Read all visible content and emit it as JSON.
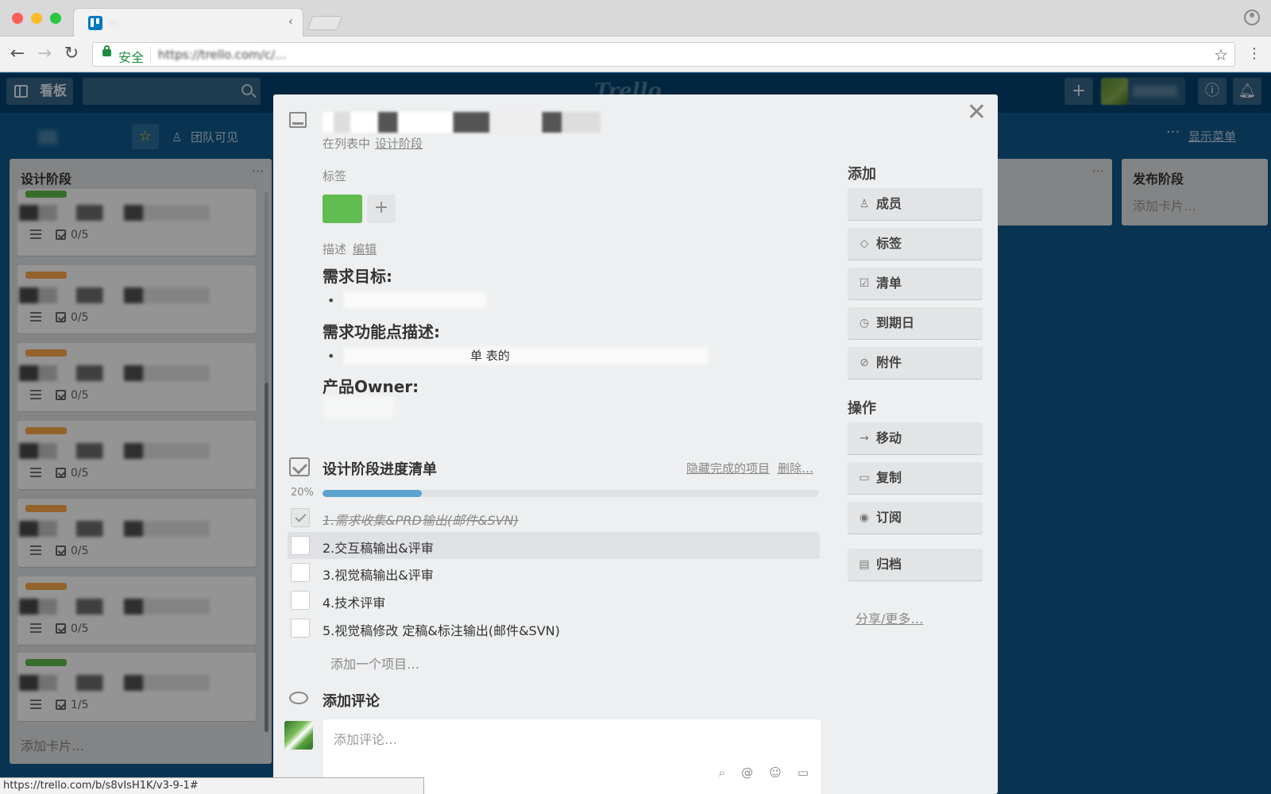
{
  "browser": {
    "secure_label": "安全",
    "url": "https://trello.com/c/...",
    "tab_title": "...",
    "status_url": "https://trello.com/b/s8vIsH1K/v3-9-1#"
  },
  "header": {
    "boards_label": "看板",
    "logo_text": "Trello"
  },
  "board_bar": {
    "visibility": "团队可见",
    "show_menu": "显示菜单"
  },
  "lists": {
    "design": {
      "title": "设计阶段",
      "add_card": "添加卡片…",
      "cards": [
        {
          "label_color": "#61bd4f",
          "checklist": "0/5"
        },
        {
          "label_color": "#ffab4a",
          "checklist": "0/5"
        },
        {
          "label_color": "#ffab4a",
          "checklist": "0/5"
        },
        {
          "label_color": "#ffab4a",
          "checklist": "0/5"
        },
        {
          "label_color": "#ffab4a",
          "checklist": "0/5"
        },
        {
          "label_color": "#ffab4a",
          "checklist": "0/5"
        },
        {
          "label_color": "#61bd4f",
          "checklist": "1/5"
        }
      ]
    },
    "release": {
      "title": "发布阶段",
      "add_card": "添加卡片…"
    }
  },
  "modal": {
    "in_list_prefix": "在列表中",
    "in_list_name": "设计阶段",
    "labels_heading": "标签",
    "label_color": "#61bd4f",
    "description_heading": "描述",
    "description_edit": "编辑",
    "desc_goal_heading": "需求目标:",
    "desc_feature_heading": "需求功能点描述:",
    "desc_feature_fragment": "单 表的",
    "desc_owner_heading": "产品Owner:",
    "checklist": {
      "title": "设计阶段进度清单",
      "hide_completed": "隐藏完成的项目",
      "delete": "删除…",
      "progress_label": "20%",
      "progress_value": 0.2,
      "items": [
        {
          "text": "1.需求收集&PRD输出(邮件&SVN)",
          "done": true
        },
        {
          "text": "2.交互稿输出&评审",
          "done": false
        },
        {
          "text": "3.视觉稿输出&评审",
          "done": false
        },
        {
          "text": "4.技术评审",
          "done": false
        },
        {
          "text": "5.视觉稿修改 定稿&标注输出(邮件&SVN)",
          "done": false
        }
      ],
      "add_item": "添加一个项目…"
    },
    "comment": {
      "title": "添加评论",
      "placeholder": "添加评论…"
    },
    "sidebar": {
      "add_heading": "添加",
      "add_buttons": [
        {
          "label": "成员",
          "icon": "member-icon"
        },
        {
          "label": "标签",
          "icon": "label-icon"
        },
        {
          "label": "清单",
          "icon": "checklist-icon"
        },
        {
          "label": "到期日",
          "icon": "clock-icon"
        },
        {
          "label": "附件",
          "icon": "paperclip-icon"
        }
      ],
      "actions_heading": "操作",
      "action_buttons": [
        {
          "label": "移动",
          "icon": "arrow-right-icon"
        },
        {
          "label": "复制",
          "icon": "copy-icon"
        },
        {
          "label": "订阅",
          "icon": "eye-icon"
        }
      ],
      "archive_label": "归档",
      "share_more": "分享/更多…"
    }
  }
}
